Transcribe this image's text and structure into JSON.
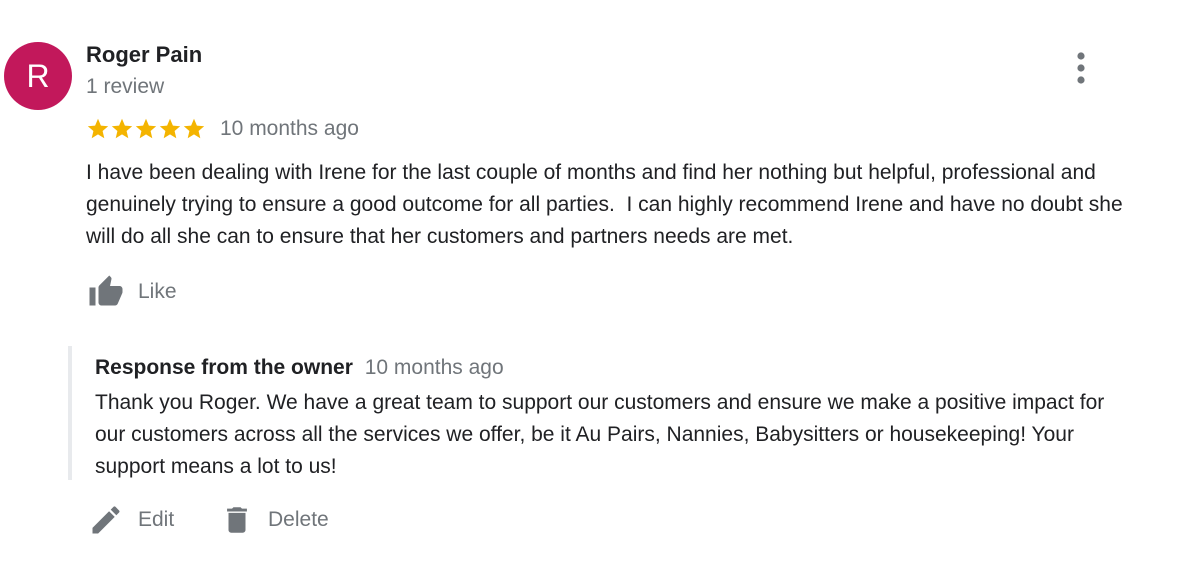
{
  "reviewer": {
    "avatar_letter": "R",
    "avatar_color": "#c2185b",
    "name": "Roger Pain",
    "review_count": "1 review"
  },
  "rating": {
    "stars": 5,
    "max": 5,
    "star_color": "#f4b400"
  },
  "review": {
    "date": "10 months ago",
    "text": "I have been dealing with Irene for the last couple of months and find her nothing but helpful, professional and genuinely trying to ensure a good outcome for all parties.  I can highly recommend Irene and have no doubt she will do all she can to ensure that her customers and partners needs are met."
  },
  "actions": {
    "like_label": "Like",
    "more_icon": "more-vert-icon"
  },
  "owner_response": {
    "title": "Response from the owner",
    "date": "10 months ago",
    "text": "Thank you Roger. We have a great team to support our customers and ensure we make a positive impact for our customers across all the services we offer, be it Au Pairs, Nannies, Babysitters or housekeeping! Your support means a lot to us!"
  },
  "response_actions": {
    "edit_label": "Edit",
    "delete_label": "Delete"
  }
}
